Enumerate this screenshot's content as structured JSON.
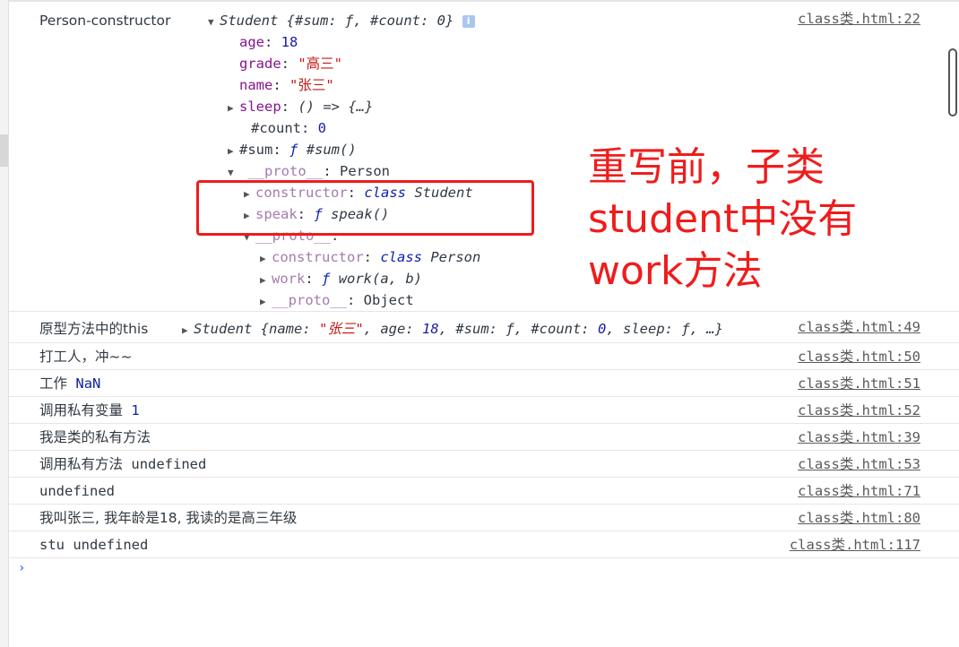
{
  "obj": {
    "label": "Person-constructor",
    "summary_class": "Student",
    "summary_fields": "{#sum: ƒ, #count: 0}",
    "info_icon": "i",
    "link": "class类.html:22",
    "age_key": "age",
    "age_val": "18",
    "grade_key": "grade",
    "grade_val": "\"高三\"",
    "name_key": "name",
    "name_val": "\"张三\"",
    "sleep_key": "sleep",
    "sleep_val": "() => {…}",
    "count_key": "#count",
    "count_val": "0",
    "sum_key": "#sum",
    "sum_f": "ƒ",
    "sum_val": "#sum()",
    "proto_key": "__proto__",
    "proto_val": "Person",
    "ctor_key": "constructor",
    "ctor_kw": "class",
    "ctor_val": "Student",
    "speak_key": "speak",
    "speak_f": "ƒ",
    "speak_val": "speak()",
    "proto2_key": "__proto__",
    "ctor2_key": "constructor",
    "ctor2_kw": "class",
    "ctor2_val": "Person",
    "work_key": "work",
    "work_f": "ƒ",
    "work_val": "work(a, b)",
    "proto3_key": "__proto__",
    "proto3_val": "Object"
  },
  "annotation": {
    "line1": "重写前，子类",
    "line2": "student中没有",
    "line3": "work方法"
  },
  "messages": [
    {
      "label": "原型方法中的this",
      "class": "Student",
      "fields_a": "{name: ",
      "str": "\"张三\"",
      "fields_b": ", age: ",
      "n1": "18",
      "fields_c": ", #sum: ƒ, #count: ",
      "n2": "0",
      "fields_d": ", sleep: ƒ, …}",
      "link": "class类.html:49"
    },
    {
      "text": "打工人，冲~~",
      "link": "class类.html:50"
    },
    {
      "text": "工作",
      "value": "NaN",
      "link": "class类.html:51"
    },
    {
      "text": "调用私有变量",
      "value": "1",
      "link": "class类.html:52"
    },
    {
      "text": "我是类的私有方法",
      "link": "class类.html:39"
    },
    {
      "text": "调用私有方法",
      "value": "undefined",
      "link": "class类.html:53"
    },
    {
      "text": "undefined",
      "link": "class类.html:71"
    },
    {
      "text": "我叫张三, 我年龄是18, 我读的是高三年级",
      "link": "class类.html:80"
    },
    {
      "text": "stu",
      "value": "undefined",
      "link": "class类.html:117"
    }
  ],
  "prompt_icon": "chevron-right-icon",
  "prompt_glyph": "›"
}
